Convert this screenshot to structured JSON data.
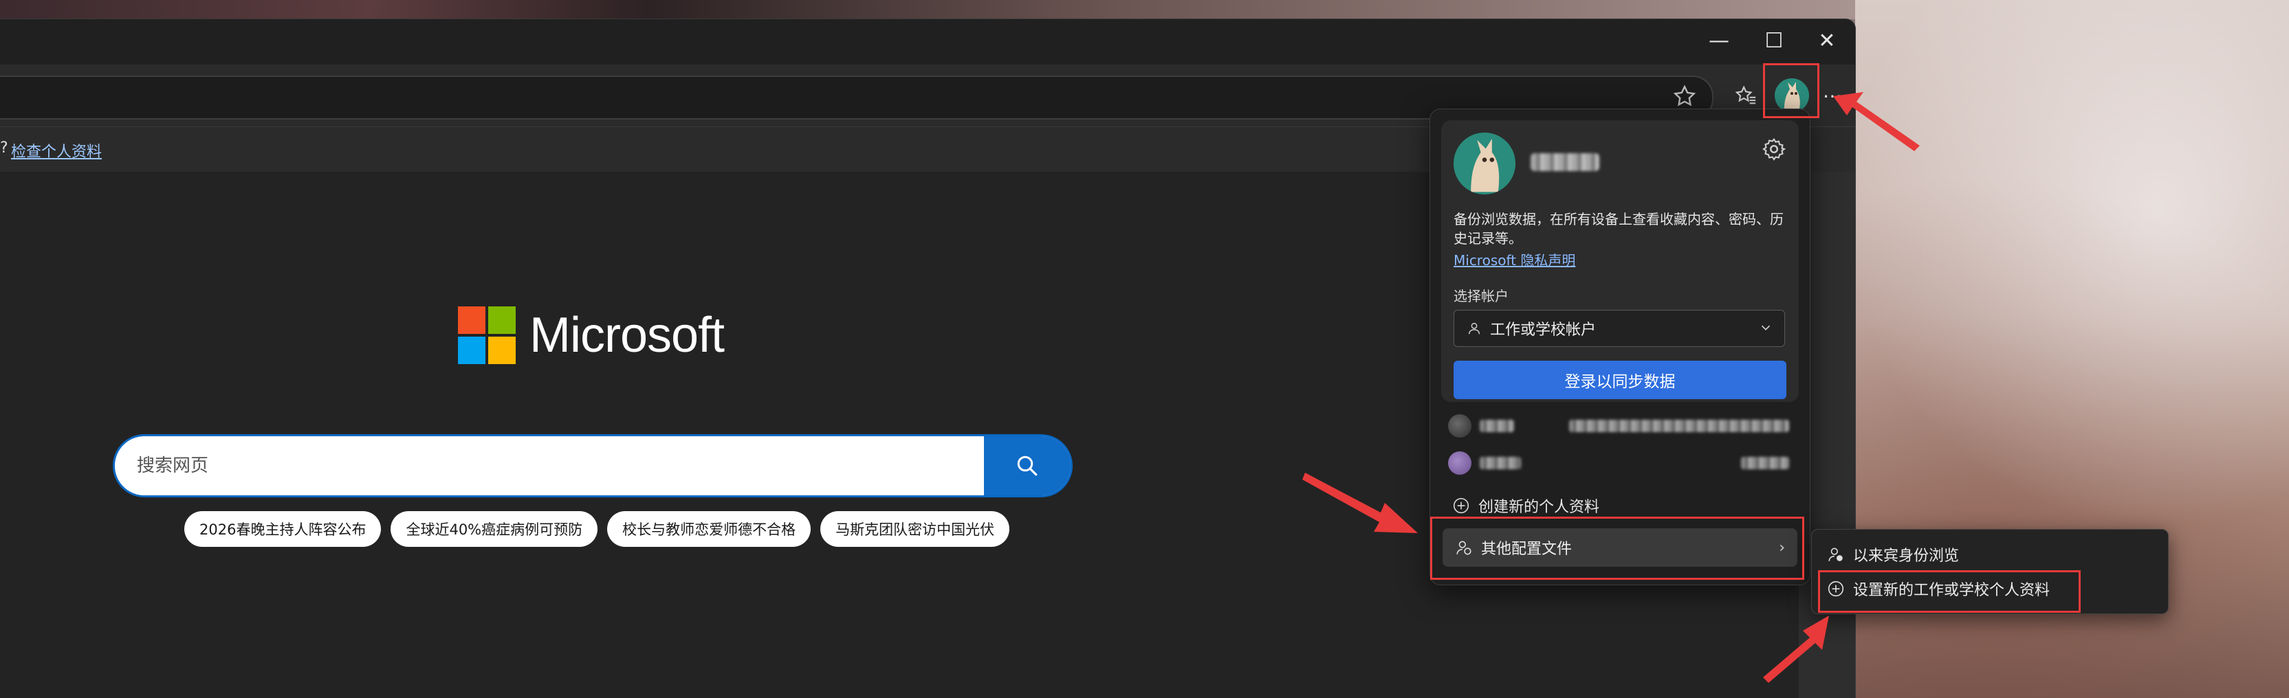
{
  "window": {
    "minimize": "—",
    "maximize": "☐",
    "close": "✕"
  },
  "infobar": {
    "prefix": "?",
    "link": "检查个人资料"
  },
  "brand": {
    "name": "Microsoft"
  },
  "search": {
    "placeholder": "搜索网页"
  },
  "trending": [
    "2026春晚主持人阵容公布",
    "全球近40%癌症病例可预防",
    "校长与教师恋爱师德不合格",
    "马斯克团队密访中国光伏"
  ],
  "profile": {
    "description": "备份浏览数据，在所有设备上查看收藏内容、密码、历史记录等。",
    "privacy_link": "Microsoft 隐私声明",
    "choose_account_label": "选择帐户",
    "account_type": "工作或学校帐户",
    "signin_button": "登录以同步数据",
    "create_profile": "创建新的个人资料",
    "other_profiles": "其他配置文件",
    "other_arrow": "›"
  },
  "submenu": {
    "guest": "以来宾身份浏览",
    "new_work_profile": "设置新的工作或学校个人资料"
  },
  "colors": {
    "accent": "#0f6cc7",
    "signin": "#2f6fde",
    "annotation": "#e83a3a",
    "ms_red": "#f25022",
    "ms_green": "#7fba00",
    "ms_blue": "#00a4ef",
    "ms_yellow": "#ffb900"
  }
}
